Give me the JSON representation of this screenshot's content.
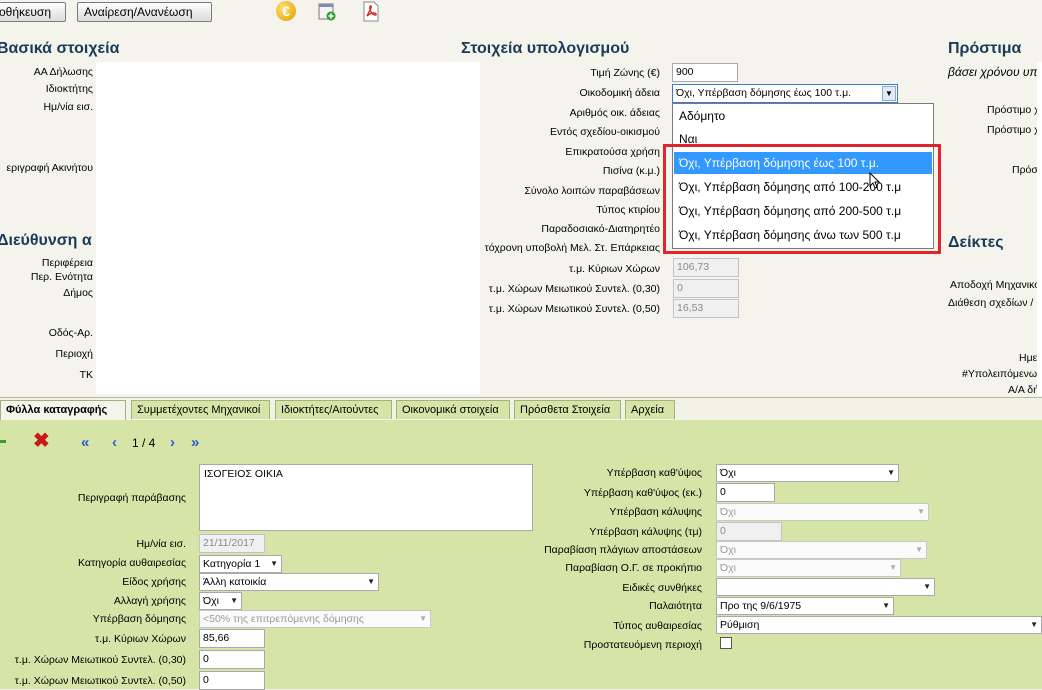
{
  "toolbar": {
    "save_label": "οθήκευση",
    "undo_refresh_label": "Αναίρεση/Ανανέωση",
    "icons": [
      "euro-icon",
      "add-document-icon",
      "pdf-icon"
    ]
  },
  "basic": {
    "title": "Βασικά στοιχεία",
    "labels": [
      "ΑΑ Δήλωσης",
      "Ιδιοκτήτης",
      "Ημ/νία εισ.",
      "εριγραφή Ακινήτου"
    ]
  },
  "address": {
    "title": "Διεύθυνση α",
    "labels": [
      "Περιφέρεια",
      "Περ. Ενότητα",
      "Δήμος",
      "Οδός-Αρ.",
      "Περιοχή",
      "ΤΚ"
    ]
  },
  "calc": {
    "title": "Στοιχεία υπολογισμού",
    "zone_price_label": "Τιμή Ζώνης (€)",
    "zone_price_value": "900",
    "permit_label": "Οικοδομική άδεια",
    "permit_value": "Όχι, Υπέρβαση δόμησης έως 100 τ.μ.",
    "labels": [
      "Αριθμός οικ. άδειας",
      "Εντός σχεδίου-οικισμού",
      "Επικρατούσα χρήση",
      "Πισίνα (κ.μ.)",
      "Σύνολο λοιπών παραβάσεων",
      "Τύπος κτιρίου",
      "Παραδοσιακό-Διατηρητέο",
      "τόχρονη υποβολή Μελ. Στ. Επάρκειας"
    ],
    "main_area_label": "τ.μ. Κύριων Χώρων",
    "main_area_value": "106,73",
    "aux030_label": "τ.μ. Χώρων Μειωτικού Συντελ. (0,30)",
    "aux030_value": "0",
    "aux050_label": "τ.μ. Χώρων Μειωτικού Συντελ. (0,50)",
    "aux050_value": "16,53"
  },
  "dropdown": {
    "options": [
      "Αδόμητο",
      "Ναι",
      "Όχι, Υπέρβαση δόμησης έως 100 τ.μ.",
      "Όχι, Υπέρβαση δόμησης από 100-200 τ.μ",
      "Όχι, Υπέρβαση δόμησης από 200-500 τ.μ",
      "Όχι, Υπέρβαση δόμησης άνω των 500 τ.μ"
    ],
    "highlighted_index": 2
  },
  "penalties": {
    "title": "Πρόστιμα",
    "subtitle": "βάσει χρόνου υπαγ",
    "labels": [
      "Πρόστιμο χ",
      "Πρόστιμο χ",
      "Πρόστ"
    ]
  },
  "indicators": {
    "title": "Δείκτες",
    "labels": [
      "Αποδοχή Μηχανικο",
      "Διάθεση σχεδίων / Π",
      "Ημερ",
      "#Υπολειπόμενων",
      "Α/Α δή"
    ]
  },
  "tabs": [
    "Φύλλα καταγραφής",
    "Συμμετέχοντες Μηχανικοί",
    "Ιδιοκτήτες/Αιτούντες",
    "Οικονομικά στοιχεία",
    "Πρόσθετα Στοιχεία",
    "Αρχεία"
  ],
  "records": {
    "pager": "1 / 4",
    "left": {
      "description_label": "Περιγραφή παράβασης",
      "description_value": "ΙΣΟΓΕΙΟΣ ΟΙΚΙΑ",
      "date_label": "Ημ/νία εισ.",
      "date_value": "21/11/2017",
      "category_label": "Κατηγορία αυθαιρεσίας",
      "category_value": "Κατηγορία 1",
      "use_label": "Είδος χρήσης",
      "use_value": "Άλλη κατοικία",
      "change_label": "Αλλαγή χρήσης",
      "change_value": "Όχι",
      "exceed_label": "Υπέρβαση δόμησης",
      "exceed_value": "<50% της επιτρεπόμενης δόμησης",
      "main_label": "τ.μ. Κύριων Χώρων",
      "main_value": "85,66",
      "c030_label": "τ.μ. Χώρων Μειωτικού Συντελ. (0,30)",
      "c030_value": "0",
      "c050_label": "τ.μ. Χώρων Μειωτικού Συντελ. (0,50)",
      "c050_value": "0"
    },
    "right": {
      "height_label": "Υπέρβαση καθ'ύψος",
      "height_value": "Όχι",
      "height_cm_label": "Υπέρβαση καθ'ύψος (εκ.)",
      "height_cm_value": "0",
      "coverage_label": "Υπέρβαση κάλυψης",
      "coverage_value": "Όχι",
      "coverage_m2_label": "Υπέρβαση κάλυψης (τμ)",
      "coverage_m2_value": "0",
      "side_label": "Παραβίαση πλάγιων αποστάσεων",
      "side_value": "Όχι",
      "og_label": "Παραβίαση Ο.Γ. σε προκήπιο",
      "og_value": "Όχι",
      "special_label": "Ειδικές συνθήκες",
      "special_value": "",
      "age_label": "Παλαιότητα",
      "age_value": "Προ της 9/6/1975",
      "type_label": "Τύπος αυθαιρεσίας",
      "type_value": "Ρύθμιση",
      "protected_label": "Προστατευόμενη περιοχή"
    }
  }
}
